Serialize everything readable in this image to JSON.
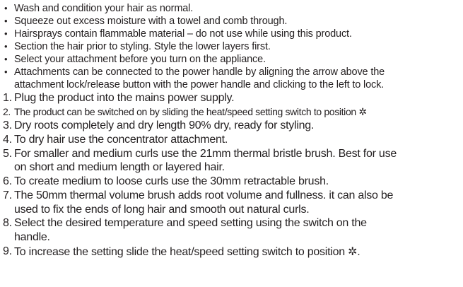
{
  "bullets": [
    {
      "marker": "•",
      "lines": [
        "Wash and condition your hair as normal."
      ]
    },
    {
      "marker": "•",
      "lines": [
        "Squeeze out excess moisture with a towel and comb through."
      ]
    },
    {
      "marker": "•",
      "lines": [
        "Hairsprays contain flammable material – do not use while using this product."
      ]
    },
    {
      "marker": "•",
      "lines": [
        "Section the hair prior to styling. Style the lower layers first."
      ]
    },
    {
      "marker": "•",
      "lines": [
        "Select your attachment before you turn on the appliance."
      ]
    },
    {
      "marker": "•",
      "lines": [
        "Attachments can be connected to the power handle by aligning the arrow above the",
        "attachment lock/release button with the power handle and clicking to the left to lock."
      ]
    }
  ],
  "steps": [
    {
      "marker": "1.",
      "lines": [
        "Plug the product into the mains power supply."
      ]
    },
    {
      "marker": "2.",
      "lines": [
        "The product can be switched on by sliding the heat/speed setting switch to position"
      ],
      "symbol": "✲"
    },
    {
      "marker": "3.",
      "lines": [
        "Dry roots completely and dry length 90% dry, ready for styling."
      ]
    },
    {
      "marker": "4.",
      "lines": [
        "To dry hair use the concentrator attachment."
      ]
    },
    {
      "marker": "5.",
      "lines": [
        "For smaller and medium curls use the 21mm thermal bristle brush. Best for use",
        "on short and medium length or layered hair."
      ]
    },
    {
      "marker": "6.",
      "lines": [
        "To create medium to loose curls use the 30mm retractable brush."
      ]
    },
    {
      "marker": "7.",
      "lines": [
        "The 50mm thermal volume brush adds root volume and fullness. it can also be",
        "used to fix the ends of long hair and smooth out natural curls."
      ]
    },
    {
      "marker": "8.",
      "lines": [
        "Select the desired temperature and speed setting using the switch on the",
        "handle."
      ]
    },
    {
      "marker": "9.",
      "lines": [
        "To increase the setting slide the heat/speed setting switch to position"
      ],
      "symbol": "✲",
      "suffix": "."
    }
  ]
}
